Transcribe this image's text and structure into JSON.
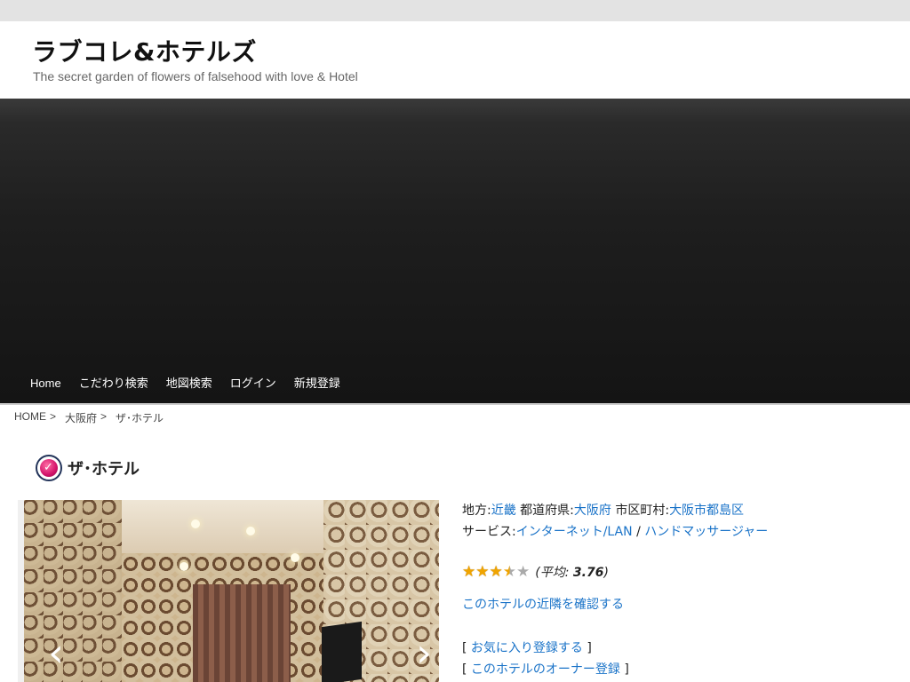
{
  "site": {
    "title": "ラブコレ&ホテルズ",
    "description": "The secret garden of flowers of falsehood with love & Hotel"
  },
  "nav": {
    "items": [
      "Home",
      "こだわり検索",
      "地図検索",
      "ログイン",
      "新規登録"
    ]
  },
  "breadcrumb": {
    "items": [
      "HOME",
      "大阪府",
      "ザ･ホテル"
    ],
    "separator": ">"
  },
  "hotel": {
    "title": "ザ･ホテル",
    "region_label": "地方:",
    "region": "近畿",
    "prefecture_label": "都道府県:",
    "prefecture": "大阪府",
    "city_label": "市区町村:",
    "city": "大阪市都島区",
    "service_label": "サービス:",
    "services": [
      "インターネット/LAN",
      "ハンドマッサージャー"
    ],
    "service_separator": "/",
    "rating": {
      "value": 3.76,
      "max": 5,
      "avg_prefix": "(平均: ",
      "avg_value": "3.76",
      "avg_suffix": ")"
    },
    "nearby_link": "このホテルの近隣を確認する",
    "favorite_link": "お気に入り登録する",
    "owner_link": "このホテルのオーナー登録"
  },
  "photo": {
    "prev_icon": "chevron-left-icon",
    "next_icon": "chevron-right-icon"
  },
  "colors": {
    "link": "#1a73c8",
    "banner": "#1e1e1e",
    "star": "#f0a400"
  }
}
